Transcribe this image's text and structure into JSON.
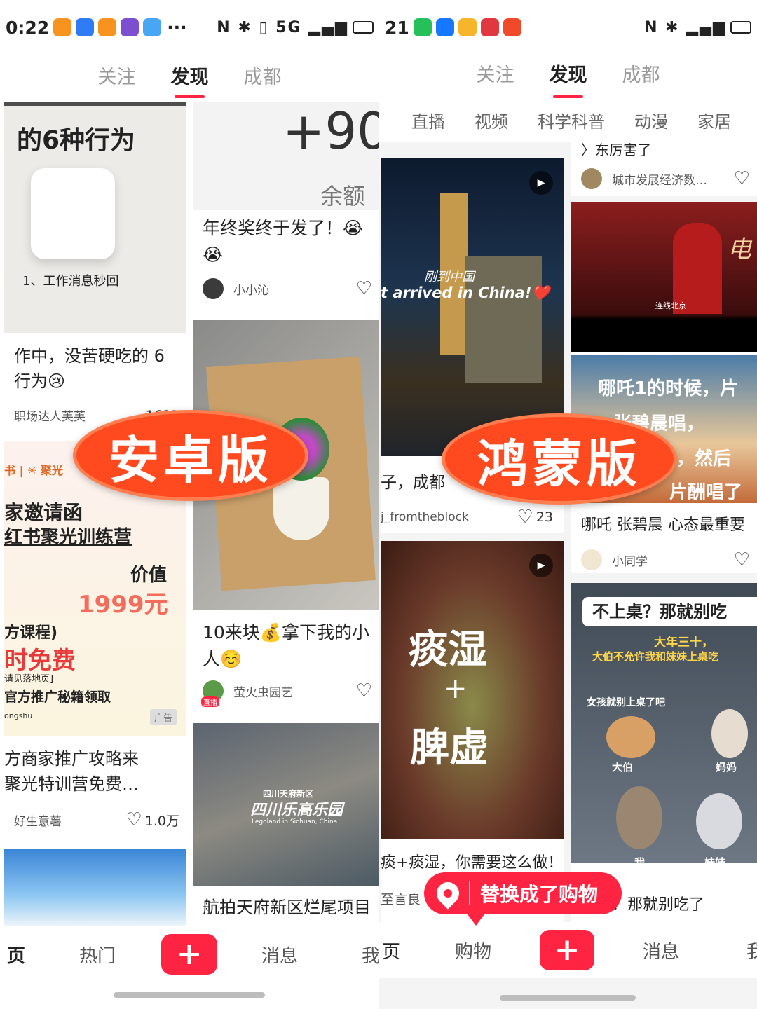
{
  "left": {
    "status": {
      "time": "0:22",
      "more": "···",
      "icons": "N ✱ ▯ 5G ▂▄▆"
    },
    "topnav": {
      "follow": "关注",
      "discover": "发现",
      "city": "成都"
    },
    "cards": [
      {
        "img_title": "的6种行为",
        "img_sub": "1、工作消息秒回",
        "caption": "作中，没苦硬吃的 6\n行为😢",
        "author": "职场达人芙芙",
        "likes": "1623"
      },
      {
        "img_big": "+90",
        "img_sub": "余额",
        "caption": "年终奖终于发了！😭\n😭",
        "author": "小小沁",
        "likes": ""
      },
      {
        "img_l1": "家邀请函",
        "img_l2": "红书聚光训练营",
        "img_l3": "价值",
        "img_l4": "1999元",
        "img_l5": "方课程)",
        "img_l6": "时免费",
        "img_l7": "请见落地页]",
        "img_l8": "官方推广秘籍领取",
        "img_l9": "ongshu",
        "img_l10": "聚光",
        "img_ad": "广告",
        "caption": "方商家推广攻略来\n聚光特训营免费…",
        "author": "好生意薯",
        "likes": "1.0万"
      },
      {
        "caption": "10来块💰拿下我的小\n人☺️",
        "author": "萤火虫园艺",
        "live": "直播",
        "likes": ""
      },
      {
        "img_l1": "四川天府新区",
        "img_l2": "四川乐高乐园",
        "img_l3": "Legoland in Sichuan, China",
        "caption": "航拍天府新区烂尾项目",
        "author": "",
        "likes": ""
      }
    ],
    "tabbar": {
      "home": "页",
      "hot": "热门",
      "plus": "+",
      "msg": "消息",
      "me": "我"
    },
    "badge": "安卓版"
  },
  "right": {
    "status": {
      "time": "21",
      "icons": "N ✱ ▂▄▆"
    },
    "topnav": {
      "follow": "关注",
      "discover": "发现",
      "city": "成都"
    },
    "chips": [
      "直播",
      "视频",
      "科学科普",
      "动漫",
      "家居"
    ],
    "cards": [
      {
        "img_cn": "刚到中国",
        "img_en": "t arrived in China!❤️",
        "caption": "子，成都",
        "author": "j_fromtheblock",
        "likes": "23"
      },
      {
        "caption_top": "〉东厉害了",
        "author_top": "城市发展经济数…"
      },
      {
        "img_l1": "电",
        "img_l2": "连线北京",
        "img_l3": "哪吒1的时候，片",
        "img_l4": "张碧晨唱，",
        "img_l5": "，然后",
        "img_l6": "片酬唱了",
        "caption": "哪吒 张碧晨 心态最重要",
        "author": "小同学",
        "likes": ""
      },
      {
        "img_l1": "痰湿",
        "img_l2": "+",
        "img_l3": "脾虚",
        "caption": "痰+痰湿，你需要这么做！",
        "author": "至言良",
        "likes": ""
      },
      {
        "img_l1": "不上桌？那就别吃",
        "img_l2": "大年三十，",
        "img_l3": "大伯不允许我和妹妹上桌吃",
        "img_l4": "女孩就别上桌了吧",
        "cat1": "大伯",
        "cat2": "妈妈",
        "cat3": "我",
        "cat4": "妹妹",
        "caption": "上桌？那就别吃了",
        "author": "",
        "likes": ""
      }
    ],
    "tabbar": {
      "home": "页",
      "shop": "购物",
      "plus": "+",
      "msg": "消息",
      "me": "我"
    },
    "badge": "鸿蒙版",
    "shop_tip": "替换成了购物"
  }
}
